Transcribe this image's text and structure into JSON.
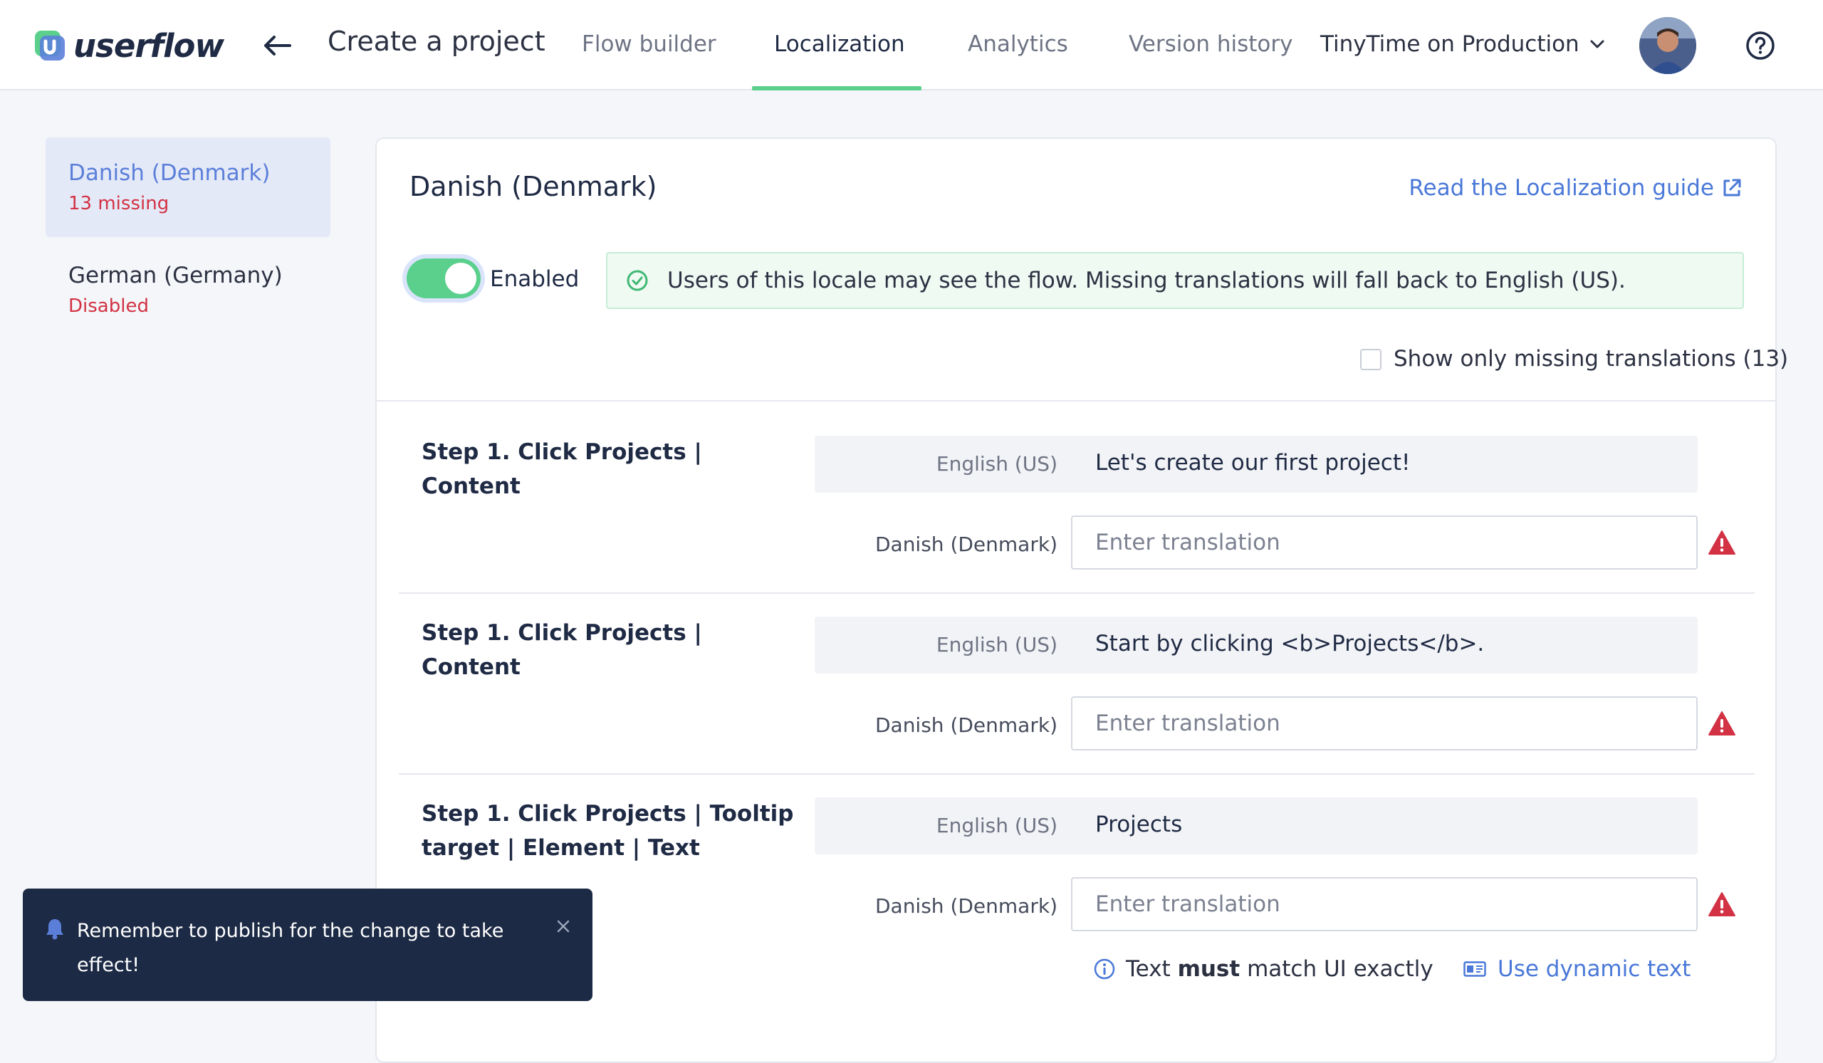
{
  "app": {
    "logo_text": "userflow",
    "project_title": "Create a project"
  },
  "nav": {
    "tabs": [
      {
        "label": "Flow builder",
        "active": false
      },
      {
        "label": "Localization",
        "active": true
      },
      {
        "label": "Analytics",
        "active": false
      },
      {
        "label": "Version history",
        "active": false
      }
    ],
    "environment": "TinyTime on Production"
  },
  "sidebar": {
    "locales": [
      {
        "name": "Danish (Denmark)",
        "status": "13 missing",
        "selected": true
      },
      {
        "name": "German (Germany)",
        "status": "Disabled",
        "selected": false
      }
    ]
  },
  "main": {
    "title": "Danish (Denmark)",
    "guide_link": "Read the Localization guide",
    "toggle": {
      "label": "Enabled",
      "on": true
    },
    "banner": "Users of this locale may see the flow. Missing translations will fall back to English (US).",
    "missing_filter": {
      "label": "Show only missing translations (13)",
      "checked": false
    },
    "source_lang": "English (US)",
    "target_lang": "Danish (Denmark)",
    "input_placeholder": "Enter translation",
    "rows": [
      {
        "step": "Step 1. Click Projects | Content",
        "source": "Let's create our first project!"
      },
      {
        "step": "Step 1. Click Projects | Content",
        "source": "Start by clicking <b>Projects</b>."
      },
      {
        "step": "Step 1. Click Projects | Tooltip target | Element | Text",
        "source": "Projects"
      }
    ],
    "hint": {
      "prefix": "Text ",
      "strong": "must",
      "suffix": " match UI exactly"
    },
    "dynamic_text_link": "Use dynamic text"
  },
  "toast": {
    "message": "Remember to publish for the change to take effect!"
  },
  "colors": {
    "accent_green": "#5ad08c",
    "link_blue": "#4a78d8",
    "error_red": "#d23244",
    "toast_bg": "#1c2a45"
  }
}
